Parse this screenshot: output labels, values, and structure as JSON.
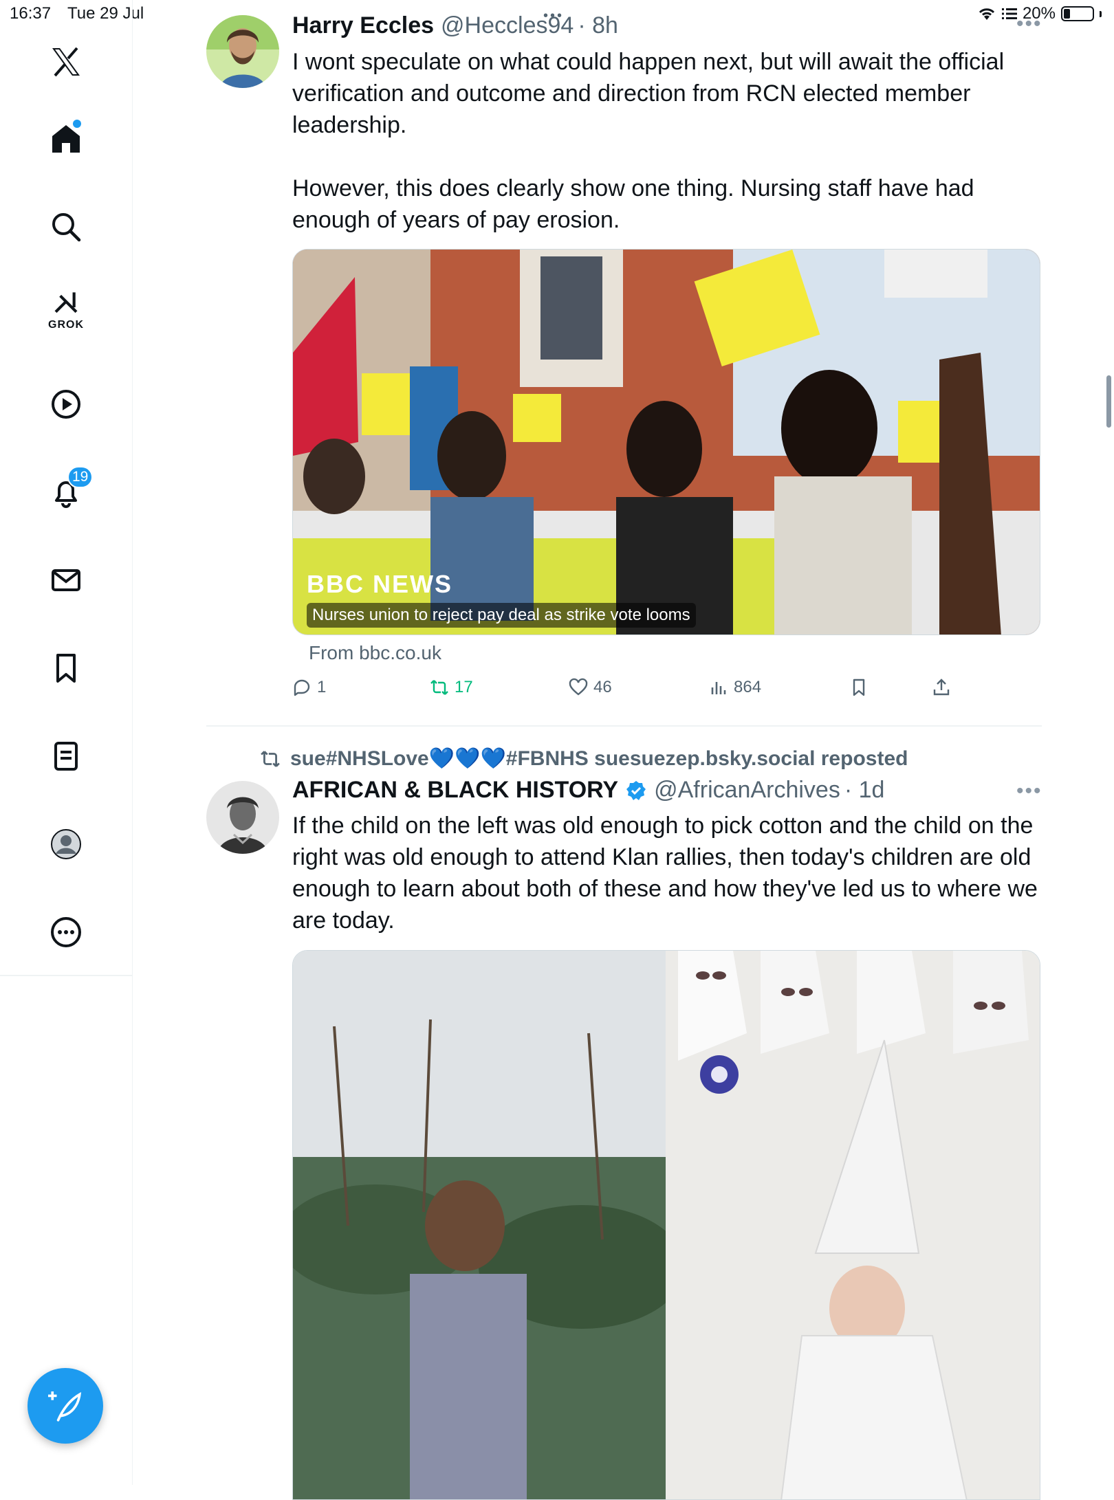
{
  "status_bar": {
    "time": "16:37",
    "date": "Tue 29 Jul",
    "battery_text": "20%",
    "battery_level": 0.2
  },
  "sidebar": {
    "grok_label": "GROK",
    "notification_count": "19",
    "items": [
      "x-logo",
      "home-icon",
      "search-icon",
      "grok-icon",
      "video-icon",
      "notifications-icon",
      "messages-icon",
      "bookmarks-icon",
      "lists-icon",
      "profile-icon",
      "more-icon"
    ]
  },
  "feed": {
    "tweet1": {
      "name": "Harry Eccles",
      "handle": "@Heccles94",
      "time": "· 8h",
      "body": "I wont speculate on what could happen next, but will await the official verification and outcome and direction from RCN elected member leadership.\n\nHowever, this does clearly show one thing. Nursing staff have had enough of years of pay erosion.",
      "card_caption": "Nurses union to reject pay deal as strike vote looms",
      "card_source": "From bbc.co.uk",
      "card_logo": "BBC NEWS",
      "stats": {
        "replies": "1",
        "reposts": "17",
        "likes": "46",
        "views": "864"
      }
    },
    "tweet2": {
      "repost_by": "sue#NHSLove💙💙💙#FBNHS suesuezep.bsky.social reposted",
      "name": "AFRICAN & BLACK HISTORY",
      "handle": "@AfricanArchives",
      "time": "· 1d",
      "body": "If the child on the left was old enough to pick cotton and the child on the right was old enough to attend Klan rallies, then today's children are old enough to learn about both of these and how they've led us to where we are today."
    }
  },
  "colors": {
    "accent": "#1d9bf0",
    "repost_green": "#00ba7c",
    "secondary_text": "#536471"
  }
}
